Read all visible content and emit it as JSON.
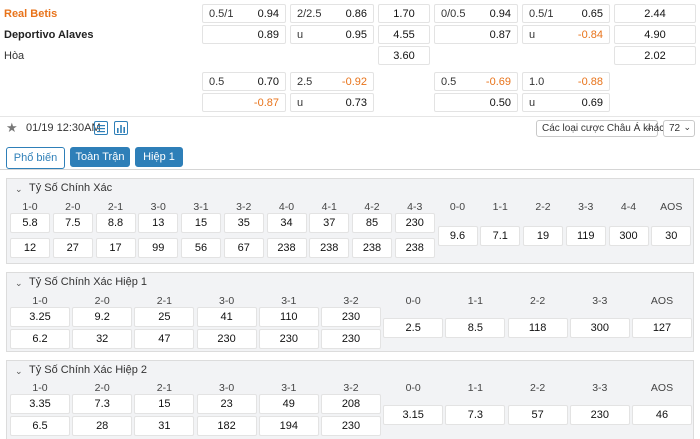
{
  "match": {
    "home": "Real Betis",
    "away": "Deportivo Alaves",
    "draw": "Hòa",
    "datetime": "01/19 12:30AM"
  },
  "odds_top": {
    "row1": [
      "0.5/1",
      "0.94",
      "2/2.5",
      "0.86",
      "1.70",
      "0/0.5",
      "0.94",
      "0.5/1",
      "0.65",
      "2.44"
    ],
    "row2": [
      "",
      "0.89",
      "u",
      "0.95",
      "4.55",
      "",
      "0.87",
      "u",
      "-0.84",
      "4.90"
    ],
    "row3": [
      "3.60",
      "2.02"
    ],
    "row4": [
      "0.5",
      "0.70",
      "2.5",
      "-0.92",
      "0.5",
      "-0.69",
      "1.0",
      "-0.88"
    ],
    "row5": [
      "-0.87",
      "u",
      "0.73",
      "0.50",
      "u",
      "0.69"
    ]
  },
  "toolbar": {
    "market_select": "Các loại cược Châu Á khác",
    "count_select": "72"
  },
  "tabs": [
    "Phổ biến",
    "Toàn Trận",
    "Hiệp 1"
  ],
  "panels": [
    {
      "title": "Tỷ Số Chính Xác",
      "headers": [
        "1-0",
        "2-0",
        "2-1",
        "3-0",
        "3-1",
        "3-2",
        "4-0",
        "4-1",
        "4-2",
        "4-3",
        "0-0",
        "1-1",
        "2-2",
        "3-3",
        "4-4",
        "AOS"
      ],
      "row_home": [
        "5.8",
        "7.5",
        "8.8",
        "13",
        "15",
        "35",
        "34",
        "37",
        "85",
        "230"
      ],
      "row_away": [
        "12",
        "27",
        "17",
        "99",
        "56",
        "67",
        "238",
        "238",
        "238",
        "238"
      ],
      "draws": [
        "9.6",
        "7.1",
        "19",
        "119",
        "300",
        "30"
      ]
    },
    {
      "title": "Tỷ Số Chính Xác Hiệp 1",
      "headers": [
        "1-0",
        "2-0",
        "2-1",
        "3-0",
        "3-1",
        "3-2",
        "0-0",
        "1-1",
        "2-2",
        "3-3",
        "AOS"
      ],
      "row_home": [
        "3.25",
        "9.2",
        "25",
        "41",
        "110",
        "230"
      ],
      "row_away": [
        "6.2",
        "32",
        "47",
        "230",
        "230",
        "230"
      ],
      "draws": [
        "2.5",
        "8.5",
        "118",
        "300",
        "127"
      ]
    },
    {
      "title": "Tỷ Số Chính Xác Hiệp 2",
      "headers": [
        "1-0",
        "2-0",
        "2-1",
        "3-0",
        "3-1",
        "3-2",
        "0-0",
        "1-1",
        "2-2",
        "3-3",
        "AOS"
      ],
      "row_home": [
        "3.35",
        "7.3",
        "15",
        "23",
        "49",
        "208"
      ],
      "row_away": [
        "6.5",
        "28",
        "31",
        "182",
        "194",
        "230"
      ],
      "draws": [
        "3.15",
        "7.3",
        "57",
        "230",
        "46"
      ]
    }
  ],
  "colors": {
    "accent": "#2e7fb8",
    "home": "#e8731a",
    "negative": "#e8731a"
  }
}
